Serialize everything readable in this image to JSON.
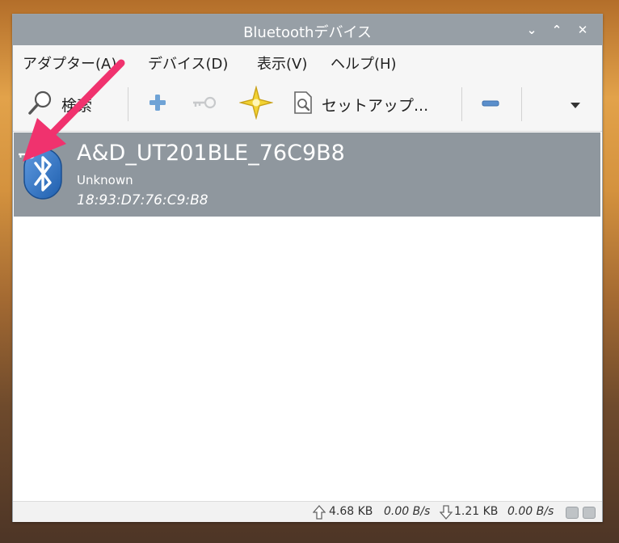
{
  "window": {
    "title": "Bluetoothデバイス",
    "controls": [
      "⌄",
      "⌃",
      "✕"
    ]
  },
  "menu": [
    {
      "label": "アダプター(A)"
    },
    {
      "label": "デバイス(D)"
    },
    {
      "label": "表示(V)"
    },
    {
      "label": "ヘルプ(H)"
    }
  ],
  "toolbar": {
    "search_label": "検索",
    "search_icon": "magnifier-icon",
    "add_icon": "plus-icon",
    "key_icon": "key-icon",
    "trust_icon": "star-icon",
    "setup_icon": "document-search-icon",
    "setup_label": "セットアップ...",
    "remove_icon": "minus-icon",
    "more_icon": "dropdown-arrow-icon"
  },
  "devices": [
    {
      "name": "A&D_UT201BLE_76C9B8",
      "class": "Unknown",
      "address": "18:93:D7:76:C9:B8",
      "icon": "bluetooth-icon",
      "badge_icon": "key-icon",
      "selected": true
    }
  ],
  "status": {
    "upload_total": "4.68 KB",
    "upload_rate": "0.00 B/s",
    "download_total": "1.21 KB",
    "download_rate": "0.00 B/s"
  },
  "colors": {
    "titlebar": "#979fa6",
    "selected_row": "#8f979e",
    "annotation_arrow": "#f0326e",
    "star": "#f2d232",
    "add_blue": "#6fa3d6"
  }
}
